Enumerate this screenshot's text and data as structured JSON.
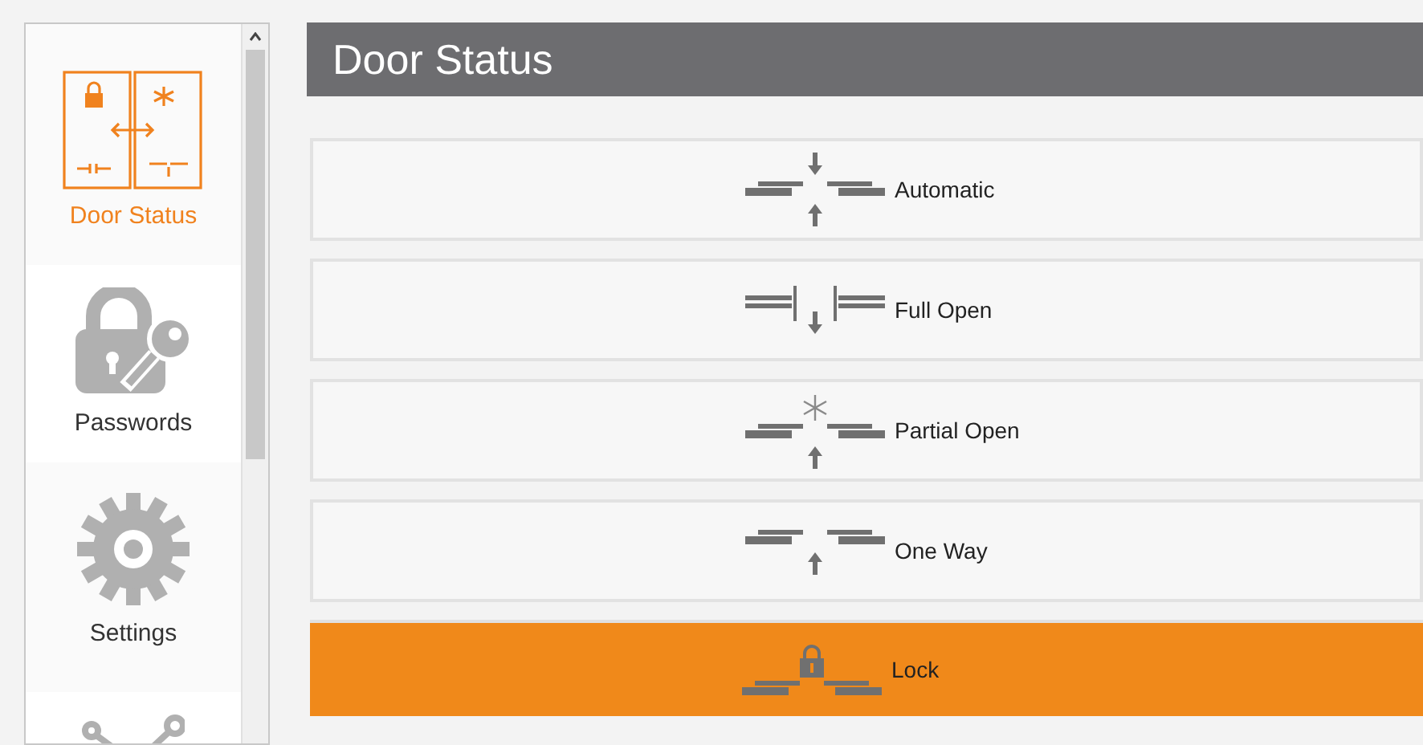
{
  "sidebar": {
    "items": [
      {
        "kind": "door_status",
        "label": "Door Status",
        "selected": true
      },
      {
        "kind": "passwords",
        "label": "Passwords",
        "selected": false
      },
      {
        "kind": "settings",
        "label": "Settings",
        "selected": false
      },
      {
        "kind": "network",
        "selected": false
      }
    ]
  },
  "header": {
    "title": "Door Status"
  },
  "modes": [
    {
      "kind": "automatic",
      "label": "Automatic",
      "selected": false
    },
    {
      "kind": "full_open",
      "label": "Full Open",
      "selected": false
    },
    {
      "kind": "partial_open",
      "label": "Partial Open",
      "selected": false
    },
    {
      "kind": "one_way",
      "label": "One Way",
      "selected": false
    },
    {
      "kind": "lock",
      "label": "Lock",
      "selected": true
    }
  ]
}
